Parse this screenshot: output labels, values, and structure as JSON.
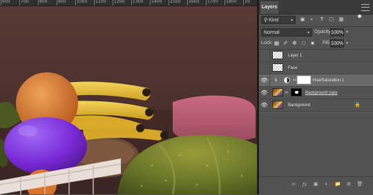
{
  "ruler": {
    "labels": [
      "600",
      "700",
      "800",
      "900",
      "1000",
      "1100",
      "1200",
      "1300",
      "1400",
      "1500",
      "1600",
      "1700",
      "1800",
      "19"
    ]
  },
  "panel": {
    "tab": "Layers",
    "filter": {
      "kind": "Kind",
      "icons": [
        "image-filter-icon",
        "adjustment-filter-icon",
        "type-filter-icon",
        "shape-filter-icon",
        "smart-object-filter-icon"
      ]
    },
    "blend_mode": "Normal",
    "opacity_label": "Opacity:",
    "opacity": "100%",
    "lock_label": "Lock:",
    "fill_label": "Fill:",
    "fill": "100%",
    "layers": [
      {
        "name": "Layer 1",
        "visible": false,
        "selected": false,
        "thumb": "transparent"
      },
      {
        "name": "Face",
        "visible": false,
        "selected": false,
        "thumb": "transparent"
      },
      {
        "name": "Hue/Saturation 1",
        "visible": true,
        "selected": true,
        "thumb": "adjustment"
      },
      {
        "name": "Background copy",
        "visible": true,
        "selected": false,
        "thumb": "photo-mask"
      },
      {
        "name": "Background",
        "visible": true,
        "selected": false,
        "thumb": "photo",
        "locked": true
      }
    ],
    "bottom_icons": [
      "link-layers-icon",
      "fx-icon",
      "add-mask-icon",
      "adjustment-layer-icon",
      "group-folder-icon",
      "new-layer-icon",
      "trash-icon"
    ],
    "fx_glyph": "fx"
  },
  "colors": {
    "canvas_bg": "#4d3430",
    "panel_bg": "#535353",
    "selected_row": "#6a6a6a",
    "lemon_purple": "#7a2bd8",
    "banana": "#e2bd2a"
  }
}
